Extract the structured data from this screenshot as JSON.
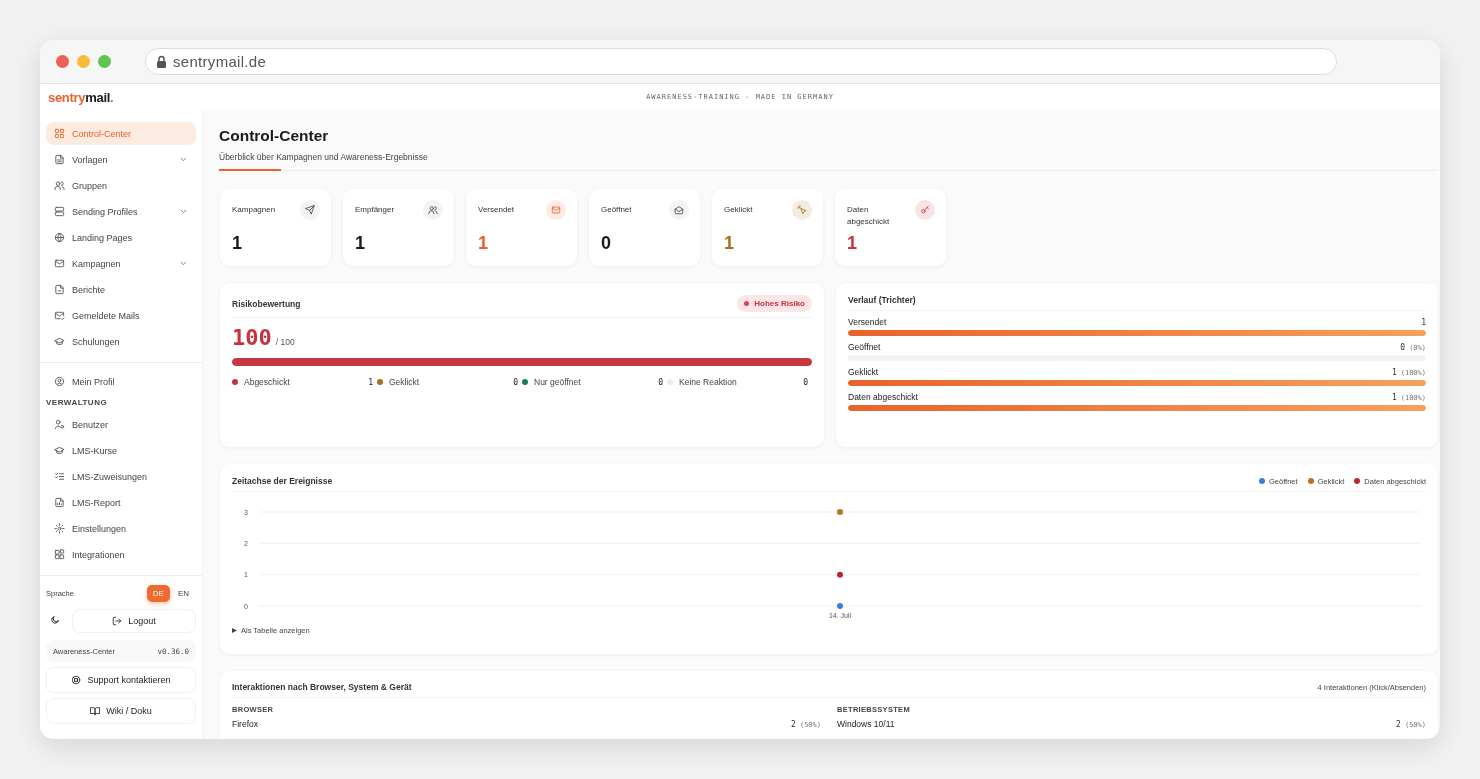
{
  "browser": {
    "url": "sentrymail.de"
  },
  "header": {
    "logo": [
      "sentry",
      "mail",
      "."
    ],
    "tagline": "AWARENESS-TRAINING - MADE IN GERMANY"
  },
  "sidebar": {
    "nav": [
      {
        "label": "Control-Center",
        "expandable": false,
        "selected": true
      },
      {
        "label": "Vorlagen",
        "expandable": true,
        "selected": false
      },
      {
        "label": "Gruppen",
        "expandable": false,
        "selected": false
      },
      {
        "label": "Sending Profiles",
        "expandable": true,
        "selected": false
      },
      {
        "label": "Landing Pages",
        "expandable": false,
        "selected": false
      },
      {
        "label": "Kampagnen",
        "expandable": true,
        "selected": false
      },
      {
        "label": "Berichte",
        "expandable": false,
        "selected": false
      },
      {
        "label": "Gemeldete Mails",
        "expandable": false,
        "selected": false
      },
      {
        "label": "Schulungen",
        "expandable": false,
        "selected": false
      }
    ],
    "profile": {
      "label": "Mein Profil",
      "selected": false
    },
    "admin": {
      "heading": "VERWALTUNG",
      "items": [
        {
          "label": "Benutzer",
          "selected": false
        },
        {
          "label": "LMS-Kurse",
          "selected": false
        },
        {
          "label": "LMS-Zuweisungen",
          "selected": false
        },
        {
          "label": "LMS-Report",
          "selected": false
        },
        {
          "label": "Einstellungen",
          "selected": false
        },
        {
          "label": "Integrationen",
          "selected": false
        }
      ]
    },
    "language": {
      "label": "Sprache",
      "options": [
        {
          "label": "DE",
          "selected": true
        },
        {
          "label": "EN",
          "selected": false
        }
      ]
    },
    "logout": "Logout",
    "version": {
      "name": "Awareness-Center",
      "number": "v0.36.0"
    },
    "links": [
      "Support kontaktieren",
      "Wiki / Doku"
    ]
  },
  "page": {
    "title": "Control-Center",
    "subtitle": "Überblick über Kampagnen und Awareness-Ergebnisse"
  },
  "stats": [
    {
      "label": "Kampagnen",
      "value": "1",
      "color": "#1a1a1a"
    },
    {
      "label": "Empfänger",
      "value": "1",
      "color": "#1a1a1a"
    },
    {
      "label": "Versendet",
      "value": "1",
      "color": "#e8632b"
    },
    {
      "label": "Geöffnet",
      "value": "0",
      "color": "#1a1a1a"
    },
    {
      "label": "Geklickt",
      "value": "1",
      "color": "#a8701c"
    },
    {
      "label": "Daten abgeschickt",
      "value": "1",
      "color": "#c8323c"
    }
  ],
  "risk": {
    "title": "Risikobewertung",
    "badge": "Hohes Risiko",
    "score": "100",
    "max": "/ 100",
    "level": 1,
    "legend": [
      {
        "label": "Abgeschickt",
        "count": "1",
        "color": "#c8323c"
      },
      {
        "label": "Geklickt",
        "count": "0",
        "color": "#a8701c"
      },
      {
        "label": "Nur geöffnet",
        "count": "0",
        "color": "#1f7a55"
      },
      {
        "label": "Keine Reaktion",
        "count": "0",
        "color": "#f3e8ec"
      }
    ]
  },
  "funnel": {
    "title": "Verlauf (Trichter)",
    "rows": [
      {
        "label": "Versendet",
        "value": "1",
        "level": 1
      },
      {
        "label": "Geöffnet",
        "value": "0",
        "percent": "(0%)",
        "level": 0
      },
      {
        "label": "Geklickt",
        "value": "1",
        "percent": "(100%)",
        "level": 1
      },
      {
        "label": "Daten abgeschickt",
        "value": "1",
        "percent": "(100%)",
        "level": 1
      }
    ]
  },
  "timeline": {
    "title": "Zeitachse der Ereignisse",
    "toggle": "Als Tabelle anzeigen",
    "chart_data": {
      "type": "scatter",
      "categories": [
        "14. Juli"
      ],
      "ylim": [
        0,
        3
      ],
      "yticks": [
        0,
        1,
        2,
        3
      ],
      "series": [
        {
          "name": "Geöffnet",
          "color": "#3b7ddd",
          "values": [
            0
          ]
        },
        {
          "name": "Geklickt",
          "color": "#b8741a",
          "values": [
            3
          ]
        },
        {
          "name": "Daten abgeschickt",
          "color": "#c0262d",
          "values": [
            1
          ]
        }
      ]
    }
  },
  "interactions": {
    "title": "Interaktionen nach Browser, System & Gerät",
    "summary": "4 Interaktionen (Klick/Absenden)",
    "columns": [
      {
        "heading": "BROWSER",
        "rows": [
          {
            "label": "Firefox",
            "value": "2",
            "percent": "(50%)"
          }
        ]
      },
      {
        "heading": "BETRIEBSSYSTEM",
        "rows": [
          {
            "label": "Windows 10/11",
            "value": "2",
            "percent": "(50%)"
          }
        ]
      }
    ]
  }
}
